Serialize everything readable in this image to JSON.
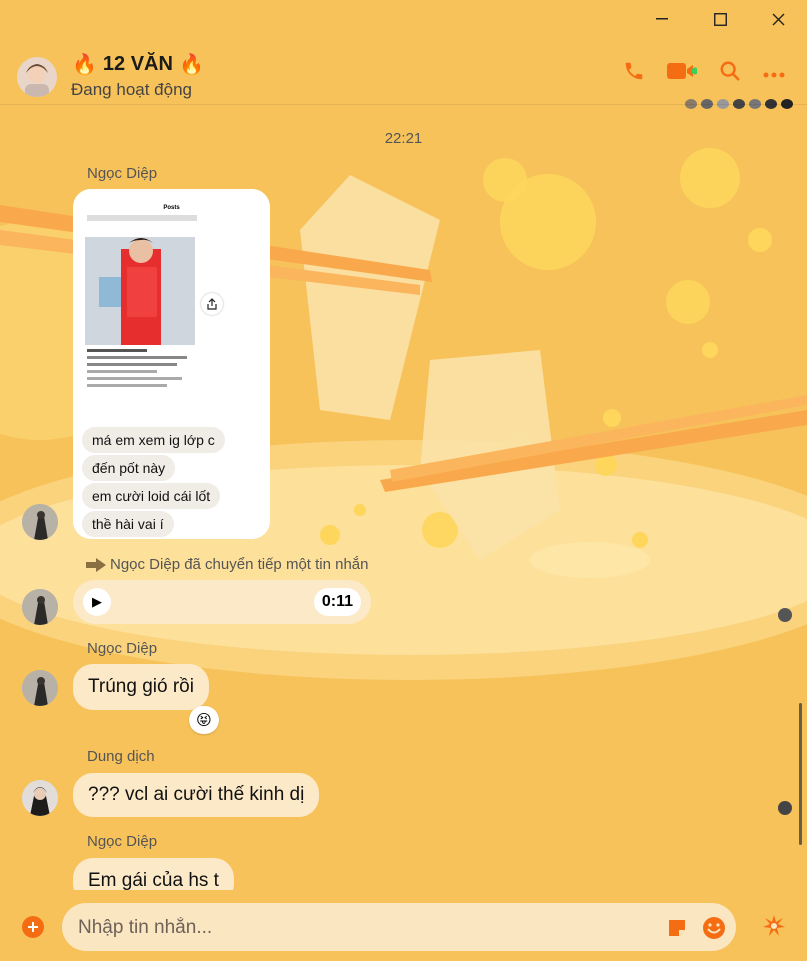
{
  "window": {
    "minimize": "—",
    "maximize": "☐",
    "close": "✕"
  },
  "header": {
    "title": "12 VĂN",
    "title_emoji": "🔥",
    "status": "Đang hoạt động",
    "icons": [
      "phone-icon",
      "video-icon",
      "search-icon",
      "more-icon"
    ],
    "accent": "#f56d12",
    "online_color": "#3dcf5a"
  },
  "conversation": {
    "timestamp": "22:21",
    "messages": [
      {
        "sender": "Ngọc Diệp",
        "type": "image",
        "image_caption_lines": [
          "má em xem ig lớp c",
          "đến pốt này",
          "em cười loid cái lốt",
          "thề hài vai í"
        ],
        "image_header": "Posts"
      },
      {
        "type": "forward_note",
        "text": "Ngọc Diệp đã chuyển tiếp một tin nhắn"
      },
      {
        "type": "audio",
        "duration": "0:11"
      },
      {
        "sender": "Ngọc Diệp",
        "type": "text",
        "text": "Trúng gió rồi",
        "reaction": "😝"
      },
      {
        "sender": "Dung dịch",
        "type": "text",
        "text": "??? vcl ai cười thế kinh dị"
      },
      {
        "sender": "Ngọc Diệp",
        "type": "text",
        "text": "Em gái của hs t"
      }
    ]
  },
  "composer": {
    "placeholder": "Nhập tin nhắn...",
    "icons": [
      "plus-icon",
      "sticker-icon",
      "emoji-icon",
      "like-icon"
    ]
  },
  "theme": {
    "background": "#f7c25a",
    "bubble": "#fce9c8"
  }
}
